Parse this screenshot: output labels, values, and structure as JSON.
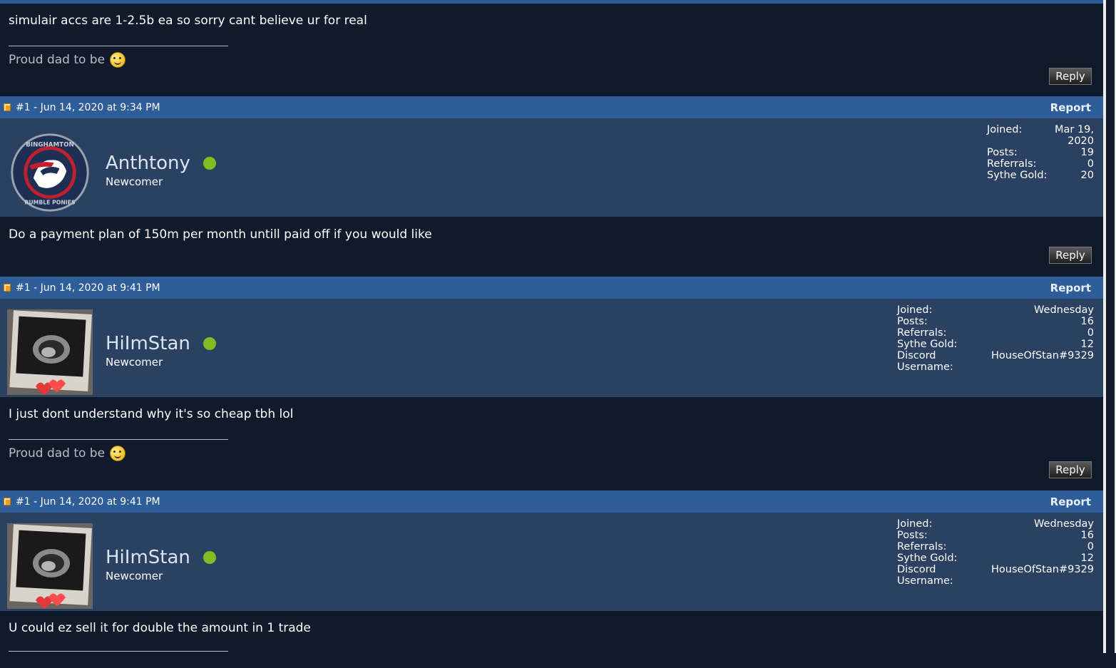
{
  "post0": {
    "message": "simulair accs are 1-2.5b ea so sorry cant believe ur for real",
    "signature": "Proud dad to be",
    "reply_label": "Reply"
  },
  "post1": {
    "header": "#1 - Jun 14, 2020 at 9:34 PM",
    "report_label": "Report",
    "username": "Anthtony",
    "user_title": "Newcomer",
    "avatar_text_top": "BINGHAMTON",
    "avatar_text_bottom": "RUMBLE PONIES",
    "stats": [
      {
        "label": "Joined:",
        "value": "Mar 19, 2020"
      },
      {
        "label": "Posts:",
        "value": "19"
      },
      {
        "label": "Referrals:",
        "value": "0"
      },
      {
        "label": "Sythe Gold:",
        "value": "20"
      }
    ],
    "message": "Do a payment plan of 150m per month untill paid off if you would like",
    "reply_label": "Reply"
  },
  "post2": {
    "header": "#1 - Jun 14, 2020 at 9:41 PM",
    "report_label": "Report",
    "username": "HiImStan",
    "user_title": "Newcomer",
    "stats": [
      {
        "label": "Joined:",
        "value": "Wednesday"
      },
      {
        "label": "Posts:",
        "value": "16"
      },
      {
        "label": "Referrals:",
        "value": "0"
      },
      {
        "label": "Sythe Gold:",
        "value": "12"
      },
      {
        "label": "Discord Username:",
        "value": "HouseOfStan#9329"
      }
    ],
    "message": "I just dont understand why it's so cheap tbh lol",
    "signature": "Proud dad to be",
    "reply_label": "Reply"
  },
  "post3": {
    "header": "#1 - Jun 14, 2020 at 9:41 PM",
    "report_label": "Report",
    "username": "HiImStan",
    "user_title": "Newcomer",
    "stats": [
      {
        "label": "Joined:",
        "value": "Wednesday"
      },
      {
        "label": "Posts:",
        "value": "16"
      },
      {
        "label": "Referrals:",
        "value": "0"
      },
      {
        "label": "Sythe Gold:",
        "value": "12"
      },
      {
        "label": "Discord Username:",
        "value": "HouseOfStan#9329"
      }
    ],
    "message": "U could ez sell it for double the amount in 1 trade"
  },
  "colors": {
    "background": "#0f1a2b",
    "header_bar": "#2e5d9a",
    "user_row": "#2b4161",
    "online": "#7fbf1f"
  }
}
